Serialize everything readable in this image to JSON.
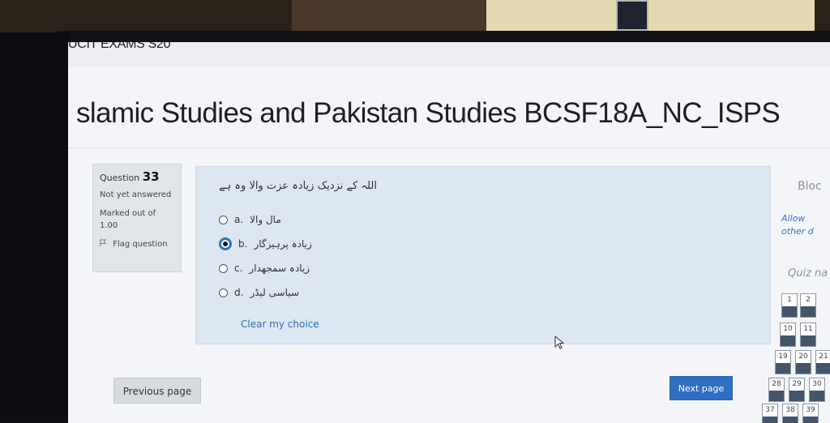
{
  "course_short": "UCIT EXAMS S20",
  "page_title": "slamic Studies and Pakistan Studies BCSF18A_NC_ISPS",
  "question": {
    "label": "Question",
    "number": "33",
    "state": "Not yet answered",
    "marks": "Marked out of 1.00",
    "flag": "Flag question",
    "text": "اللہ کے نزدیک زیادہ عزت والا وہ ہے",
    "options": [
      {
        "letter": "a.",
        "text": "مال والا",
        "selected": false
      },
      {
        "letter": "b.",
        "text": "زیادہ پرہیزگار",
        "selected": true
      },
      {
        "letter": "c.",
        "text": "زیادہ سمجھدار",
        "selected": false
      },
      {
        "letter": "d.",
        "text": "سیاسی لیڈر",
        "selected": false
      }
    ],
    "clear": "Clear my choice"
  },
  "sidebar": {
    "title": "Bloc",
    "text_line1": "Allow",
    "text_line2": "other d",
    "quiz_nav_title": "Quiz na",
    "nav_numbers": [
      "1",
      "2",
      "10",
      "11",
      "19",
      "20",
      "21",
      "28",
      "29",
      "30",
      "37",
      "38",
      "39"
    ]
  },
  "buttons": {
    "previous": "Previous page",
    "next": "Next page"
  },
  "colors": {
    "accent": "#2f6fc4",
    "question_bg": "#dde7f1",
    "info_bg": "#e1e4e8"
  }
}
